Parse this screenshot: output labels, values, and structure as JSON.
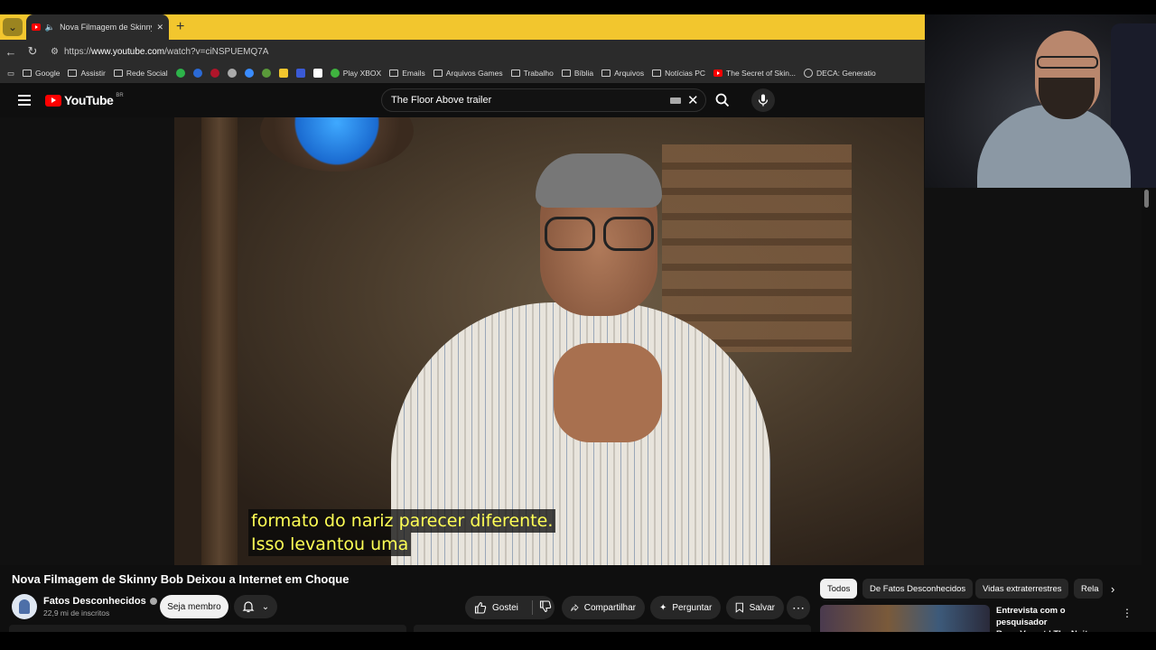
{
  "browser": {
    "tab_title": "Nova Filmagem de Skinny Bob",
    "url_prefix": "https://",
    "url_host": "www.youtube.com",
    "url_path": "/watch?v=ciNSPUEMQ7A"
  },
  "bookmarks": [
    {
      "label": "Google",
      "icon": "folder-icon"
    },
    {
      "label": "Assistir",
      "icon": "folder-icon"
    },
    {
      "label": "Rede Social",
      "icon": "folder-icon"
    },
    {
      "label": "Play XBOX",
      "icon": "xbox-icon"
    },
    {
      "label": "Emails",
      "icon": "folder-icon"
    },
    {
      "label": "Arquivos Games",
      "icon": "folder-icon"
    },
    {
      "label": "Trabalho",
      "icon": "folder-icon"
    },
    {
      "label": "Bíblia",
      "icon": "folder-icon"
    },
    {
      "label": "Arquivos",
      "icon": "folder-icon"
    },
    {
      "label": "Notícias PC",
      "icon": "folder-icon"
    },
    {
      "label": "The Secret of Skin...",
      "icon": "youtube-icon"
    },
    {
      "label": "DECA: Generatio",
      "icon": "globe-icon"
    }
  ],
  "youtube": {
    "logo_text": "YouTube",
    "country_code": "BR",
    "search_value": "The Floor Above trailer"
  },
  "video": {
    "subtitle_line1": "formato do nariz parecer diferente.",
    "subtitle_line2": "Isso levantou uma",
    "title": "Nova Filmagem de Skinny Bob Deixou a Internet em Choque"
  },
  "channel": {
    "name": "Fatos Desconhecidos",
    "subscribers": "22,9 mi de inscritos",
    "member_label": "Seja membro"
  },
  "actions": {
    "like_label": "Gostei",
    "share_label": "Compartilhar",
    "ask_label": "Perguntar",
    "save_label": "Salvar"
  },
  "chips": [
    "Todos",
    "De Fatos Desconhecidos",
    "Vidas extraterrestres",
    "Rela"
  ],
  "recommendation": {
    "title_line1": "Entrevista com o pesquisador",
    "title_line2": "Rony Vernet | The Noite ..."
  },
  "colors": {
    "tab_bar": "#f2c62e",
    "subtitle_text": "#ffff55",
    "youtube_red": "#ff0000"
  }
}
